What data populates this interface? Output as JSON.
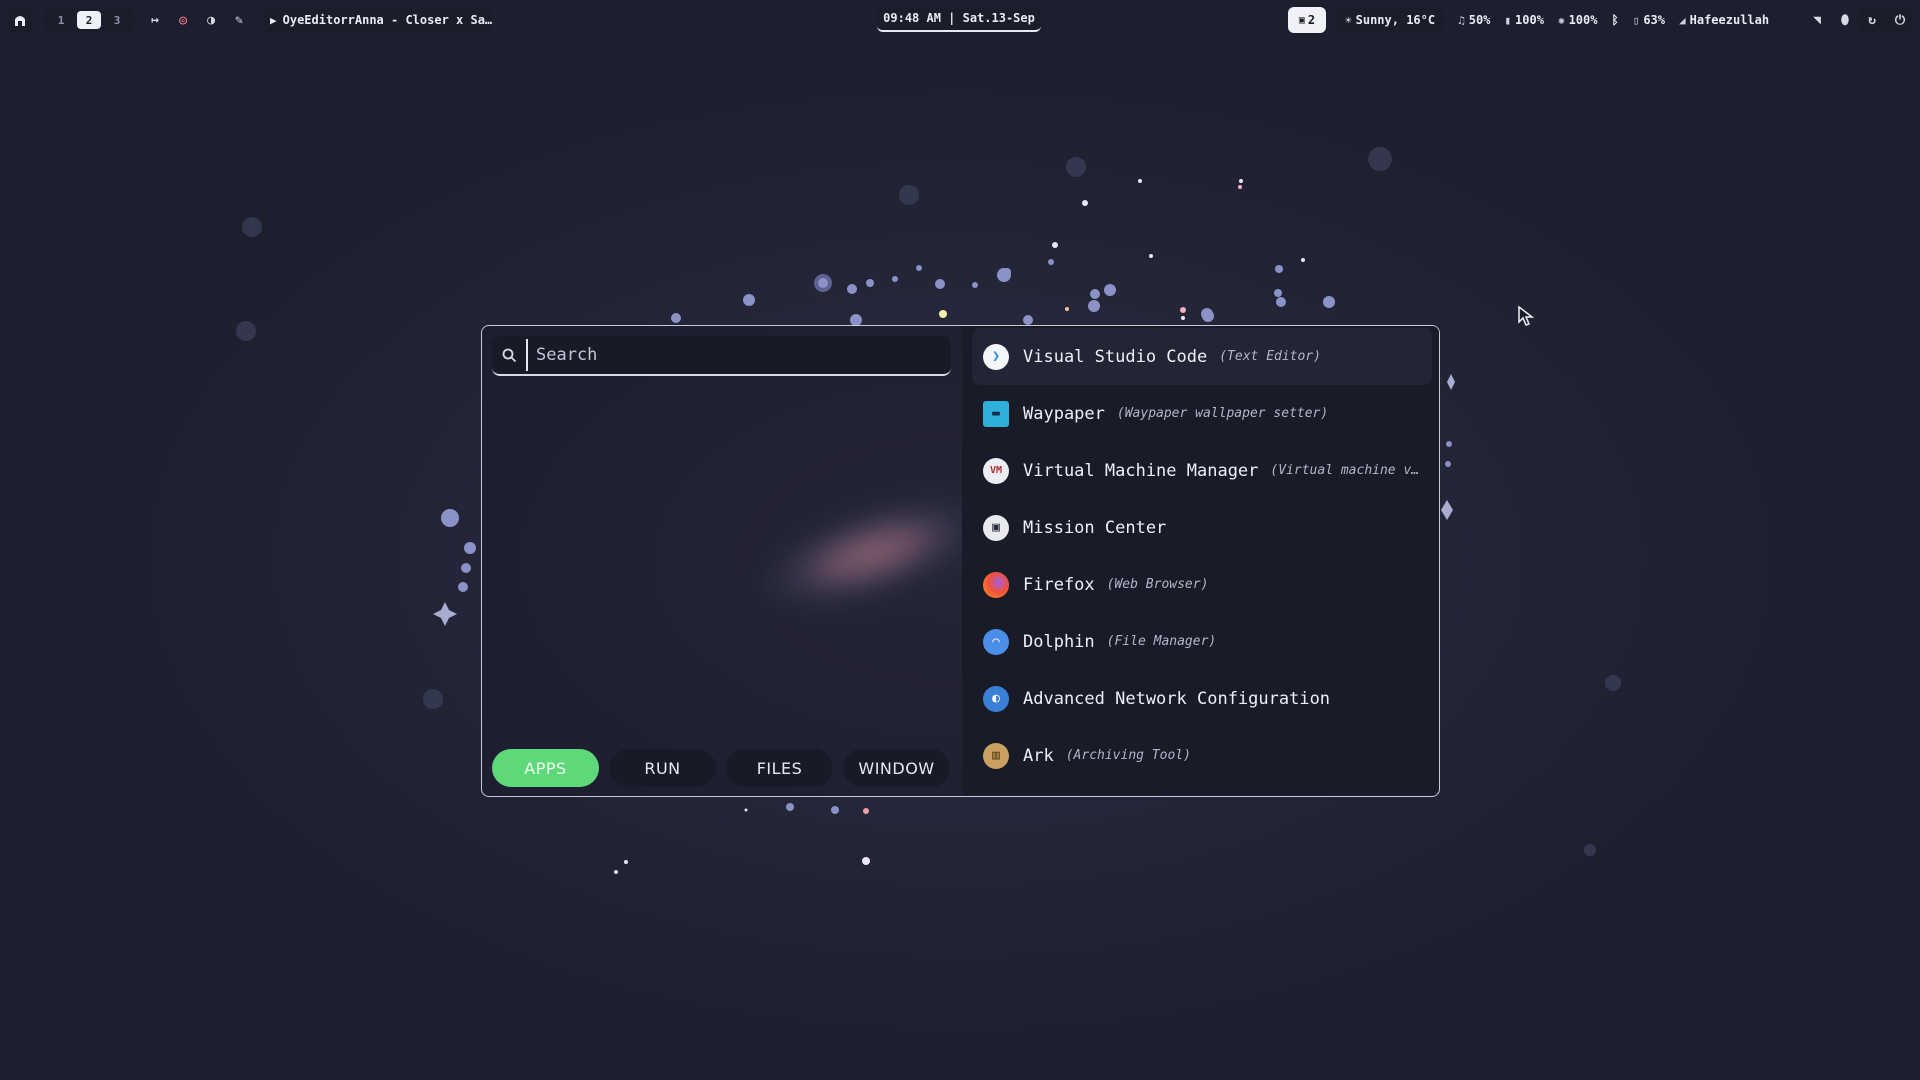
{
  "topbar": {
    "workspaces": [
      "1",
      "2",
      "3"
    ],
    "active_workspace": "2",
    "media_title": "OyeEditorrAnna - Closer x Sa…",
    "clock": "09:48 AM | Sat.13-Sep",
    "notifications_count": "2",
    "weather": "Sunny, 16°C",
    "headphone_volume": "50%",
    "mic_volume": "100%",
    "brightness": "100%",
    "battery": "63%",
    "user": "Hafeezullah"
  },
  "launcher": {
    "search": {
      "placeholder": "Search",
      "value": ""
    },
    "tabs": [
      {
        "label": "APPS",
        "active": true
      },
      {
        "label": "RUN",
        "active": false
      },
      {
        "label": "FILES",
        "active": false
      },
      {
        "label": "WINDOW",
        "active": false
      }
    ],
    "apps": [
      {
        "name": "Visual Studio Code",
        "desc": "(Text Editor)",
        "icon": "vscode-icon"
      },
      {
        "name": "Waypaper",
        "desc": "(Waypaper wallpaper setter)",
        "icon": "waypaper-icon"
      },
      {
        "name": "Virtual Machine Manager",
        "desc": "(Virtual machine v…",
        "icon": "virt-manager-icon"
      },
      {
        "name": "Mission Center",
        "desc": "",
        "icon": "mission-center-icon"
      },
      {
        "name": "Firefox",
        "desc": "(Web Browser)",
        "icon": "firefox-icon"
      },
      {
        "name": "Dolphin",
        "desc": "(File Manager)",
        "icon": "dolphin-icon"
      },
      {
        "name": "Advanced Network Configuration",
        "desc": "",
        "icon": "network-icon"
      },
      {
        "name": "Ark",
        "desc": "(Archiving Tool)",
        "icon": "ark-icon"
      }
    ]
  },
  "colors": {
    "accent_green": "#5fd87a",
    "panel": "#1a1b28",
    "bar_pill": "#1b1d2b"
  }
}
